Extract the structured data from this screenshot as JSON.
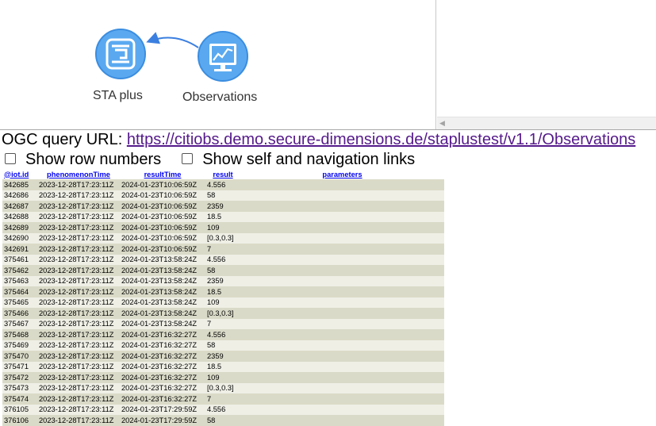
{
  "graph": {
    "nodes": [
      {
        "label": "STA plus",
        "icon": "ogc-logo-icon"
      },
      {
        "label": "Observations",
        "icon": "chart-monitor-icon"
      }
    ],
    "node_color": "#5aa9f0"
  },
  "query": {
    "label": "OGC query URL:",
    "url": "https://citiobs.demo.secure-dimensions.de/staplustest/v1.1/Observations"
  },
  "options": {
    "show_row_numbers": "Show row numbers",
    "show_links": "Show self and navigation links"
  },
  "table": {
    "headers": [
      "@iot.id",
      "phenomenonTime",
      "resultTime",
      "result",
      "parameters"
    ],
    "rows": [
      [
        "342685",
        "2023-12-28T17:23:11Z",
        "2024-01-23T10:06:59Z",
        "4.556",
        ""
      ],
      [
        "342686",
        "2023-12-28T17:23:11Z",
        "2024-01-23T10:06:59Z",
        "58",
        ""
      ],
      [
        "342687",
        "2023-12-28T17:23:11Z",
        "2024-01-23T10:06:59Z",
        "2359",
        ""
      ],
      [
        "342688",
        "2023-12-28T17:23:11Z",
        "2024-01-23T10:06:59Z",
        "18.5",
        ""
      ],
      [
        "342689",
        "2023-12-28T17:23:11Z",
        "2024-01-23T10:06:59Z",
        "109",
        ""
      ],
      [
        "342690",
        "2023-12-28T17:23:11Z",
        "2024-01-23T10:06:59Z",
        "[0.3,0.3]",
        ""
      ],
      [
        "342691",
        "2023-12-28T17:23:11Z",
        "2024-01-23T10:06:59Z",
        "7",
        ""
      ],
      [
        "375461",
        "2023-12-28T17:23:11Z",
        "2024-01-23T13:58:24Z",
        "4.556",
        ""
      ],
      [
        "375462",
        "2023-12-28T17:23:11Z",
        "2024-01-23T13:58:24Z",
        "58",
        ""
      ],
      [
        "375463",
        "2023-12-28T17:23:11Z",
        "2024-01-23T13:58:24Z",
        "2359",
        ""
      ],
      [
        "375464",
        "2023-12-28T17:23:11Z",
        "2024-01-23T13:58:24Z",
        "18.5",
        ""
      ],
      [
        "375465",
        "2023-12-28T17:23:11Z",
        "2024-01-23T13:58:24Z",
        "109",
        ""
      ],
      [
        "375466",
        "2023-12-28T17:23:11Z",
        "2024-01-23T13:58:24Z",
        "[0.3,0.3]",
        ""
      ],
      [
        "375467",
        "2023-12-28T17:23:11Z",
        "2024-01-23T13:58:24Z",
        "7",
        ""
      ],
      [
        "375468",
        "2023-12-28T17:23:11Z",
        "2024-01-23T16:32:27Z",
        "4.556",
        ""
      ],
      [
        "375469",
        "2023-12-28T17:23:11Z",
        "2024-01-23T16:32:27Z",
        "58",
        ""
      ],
      [
        "375470",
        "2023-12-28T17:23:11Z",
        "2024-01-23T16:32:27Z",
        "2359",
        ""
      ],
      [
        "375471",
        "2023-12-28T17:23:11Z",
        "2024-01-23T16:32:27Z",
        "18.5",
        ""
      ],
      [
        "375472",
        "2023-12-28T17:23:11Z",
        "2024-01-23T16:32:27Z",
        "109",
        ""
      ],
      [
        "375473",
        "2023-12-28T17:23:11Z",
        "2024-01-23T16:32:27Z",
        "[0.3,0.3]",
        ""
      ],
      [
        "375474",
        "2023-12-28T17:23:11Z",
        "2024-01-23T16:32:27Z",
        "7",
        ""
      ],
      [
        "376105",
        "2023-12-28T17:23:11Z",
        "2024-01-23T17:29:59Z",
        "4.556",
        ""
      ],
      [
        "376106",
        "2023-12-28T17:23:11Z",
        "2024-01-23T17:29:59Z",
        "58",
        ""
      ]
    ]
  }
}
